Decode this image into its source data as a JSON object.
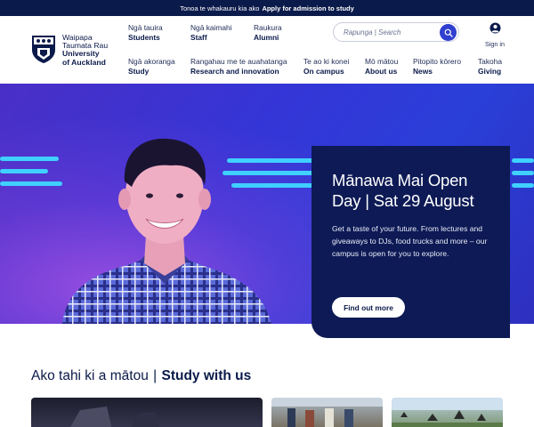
{
  "topbar": {
    "prefix": "Tonoa te whakauru kia ako",
    "link": "Apply for admission to study"
  },
  "logo": {
    "line1": "Waipapa",
    "line2": "Taumata Rau",
    "line3": "University",
    "line4": "of Auckland"
  },
  "nav_row1": [
    {
      "maori": "Ngā tauira",
      "english": "Students"
    },
    {
      "maori": "Ngā kaimahi",
      "english": "Staff"
    },
    {
      "maori": "Raukura",
      "english": "Alumni"
    }
  ],
  "nav_row2": [
    {
      "maori": "Ngā akoranga",
      "english": "Study"
    },
    {
      "maori": "Rangahau me te auahatanga",
      "english": "Research and innovation"
    },
    {
      "maori": "Te ao ki konei",
      "english": "On campus"
    },
    {
      "maori": "Mō mātou",
      "english": "About us"
    },
    {
      "maori": "Pitopito kōrero",
      "english": "News"
    },
    {
      "maori": "Takoha",
      "english": "Giving"
    }
  ],
  "search": {
    "placeholder": "Rapunga | Search",
    "icon": "search-icon"
  },
  "signin": {
    "label": "Sign in",
    "icon": "user-icon"
  },
  "hero": {
    "title": "Mānawa Mai Open Day | Sat 29 August",
    "description": "Get a taste of your future. From lectures and giveaways to DJs, food trucks and more – our campus is open for you to explore.",
    "button": "Find out more"
  },
  "study": {
    "heading_maori": "Ako tahi ki a mātou",
    "heading_separator": "|",
    "heading_english": "Study with us"
  },
  "colors": {
    "navy": "#0a1a4a",
    "hero_blue": "#3535d6",
    "accent_cyan": "#3fd0ff",
    "search_button": "#2f3fcf",
    "card_navy": "#0d1a55"
  }
}
